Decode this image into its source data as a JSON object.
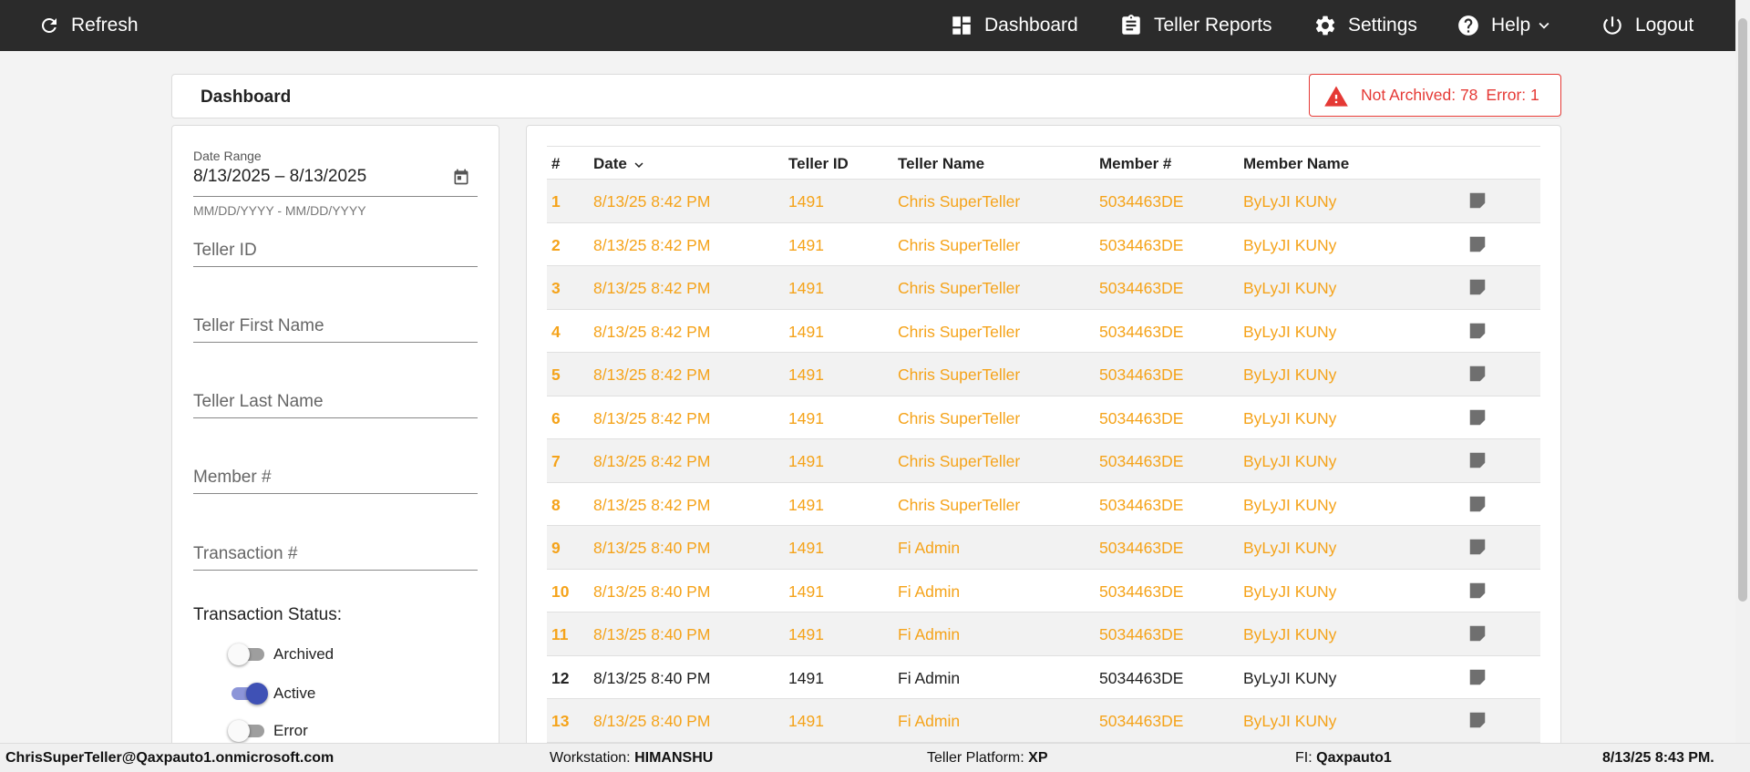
{
  "nav": {
    "refresh": "Refresh",
    "dashboard": "Dashboard",
    "teller_reports": "Teller Reports",
    "settings": "Settings",
    "help": "Help",
    "logout": "Logout"
  },
  "header": {
    "title": "Dashboard",
    "not_archived": "Not Archived: 78",
    "error": "Error: 1",
    "alert_color": "#e53935"
  },
  "filters": {
    "date_range_label": "Date Range",
    "date_range_value": "8/13/2025 – 8/13/2025",
    "date_range_hint": "MM/DD/YYYY - MM/DD/YYYY",
    "teller_id": "Teller ID",
    "teller_first_name": "Teller First Name",
    "teller_last_name": "Teller Last Name",
    "member_num": "Member #",
    "transaction_num": "Transaction #",
    "status_title": "Transaction Status:",
    "statuses": [
      {
        "label": "Archived",
        "on": false
      },
      {
        "label": "Active",
        "on": true
      },
      {
        "label": "Error",
        "on": false
      }
    ]
  },
  "table": {
    "columns": [
      "#",
      "Date",
      "Teller ID",
      "Teller Name",
      "Member #",
      "Member Name"
    ],
    "highlight_color": "#f5a31a",
    "rows": [
      {
        "num": "1",
        "date": "8/13/25 8:42 PM",
        "teller_id": "1491",
        "teller_name": "Chris SuperTeller",
        "member_num": "5034463DE",
        "member_name": "ByLyJI KUNy",
        "highlight": true
      },
      {
        "num": "2",
        "date": "8/13/25 8:42 PM",
        "teller_id": "1491",
        "teller_name": "Chris SuperTeller",
        "member_num": "5034463DE",
        "member_name": "ByLyJI KUNy",
        "highlight": true
      },
      {
        "num": "3",
        "date": "8/13/25 8:42 PM",
        "teller_id": "1491",
        "teller_name": "Chris SuperTeller",
        "member_num": "5034463DE",
        "member_name": "ByLyJI KUNy",
        "highlight": true
      },
      {
        "num": "4",
        "date": "8/13/25 8:42 PM",
        "teller_id": "1491",
        "teller_name": "Chris SuperTeller",
        "member_num": "5034463DE",
        "member_name": "ByLyJI KUNy",
        "highlight": true
      },
      {
        "num": "5",
        "date": "8/13/25 8:42 PM",
        "teller_id": "1491",
        "teller_name": "Chris SuperTeller",
        "member_num": "5034463DE",
        "member_name": "ByLyJI KUNy",
        "highlight": true
      },
      {
        "num": "6",
        "date": "8/13/25 8:42 PM",
        "teller_id": "1491",
        "teller_name": "Chris SuperTeller",
        "member_num": "5034463DE",
        "member_name": "ByLyJI KUNy",
        "highlight": true
      },
      {
        "num": "7",
        "date": "8/13/25 8:42 PM",
        "teller_id": "1491",
        "teller_name": "Chris SuperTeller",
        "member_num": "5034463DE",
        "member_name": "ByLyJI KUNy",
        "highlight": true
      },
      {
        "num": "8",
        "date": "8/13/25 8:42 PM",
        "teller_id": "1491",
        "teller_name": "Chris SuperTeller",
        "member_num": "5034463DE",
        "member_name": "ByLyJI KUNy",
        "highlight": true
      },
      {
        "num": "9",
        "date": "8/13/25 8:40 PM",
        "teller_id": "1491",
        "teller_name": "Fi Admin",
        "member_num": "5034463DE",
        "member_name": "ByLyJI KUNy",
        "highlight": true
      },
      {
        "num": "10",
        "date": "8/13/25 8:40 PM",
        "teller_id": "1491",
        "teller_name": "Fi Admin",
        "member_num": "5034463DE",
        "member_name": "ByLyJI KUNy",
        "highlight": true
      },
      {
        "num": "11",
        "date": "8/13/25 8:40 PM",
        "teller_id": "1491",
        "teller_name": "Fi Admin",
        "member_num": "5034463DE",
        "member_name": "ByLyJI KUNy",
        "highlight": true
      },
      {
        "num": "12",
        "date": "8/13/25 8:40 PM",
        "teller_id": "1491",
        "teller_name": "Fi Admin",
        "member_num": "5034463DE",
        "member_name": "ByLyJI KUNy",
        "highlight": false
      },
      {
        "num": "13",
        "date": "8/13/25 8:40 PM",
        "teller_id": "1491",
        "teller_name": "Fi Admin",
        "member_num": "5034463DE",
        "member_name": "ByLyJI KUNy",
        "highlight": true
      }
    ]
  },
  "footer": {
    "user": "ChrisSuperTeller@Qaxpauto1.onmicrosoft.com",
    "workstation_label": "Workstation:",
    "workstation": "HIMANSHU",
    "platform_label": "Teller Platform:",
    "platform": "XP",
    "fi_label": "FI:",
    "fi": "Qaxpauto1",
    "datetime": "8/13/25 8:43 PM."
  }
}
